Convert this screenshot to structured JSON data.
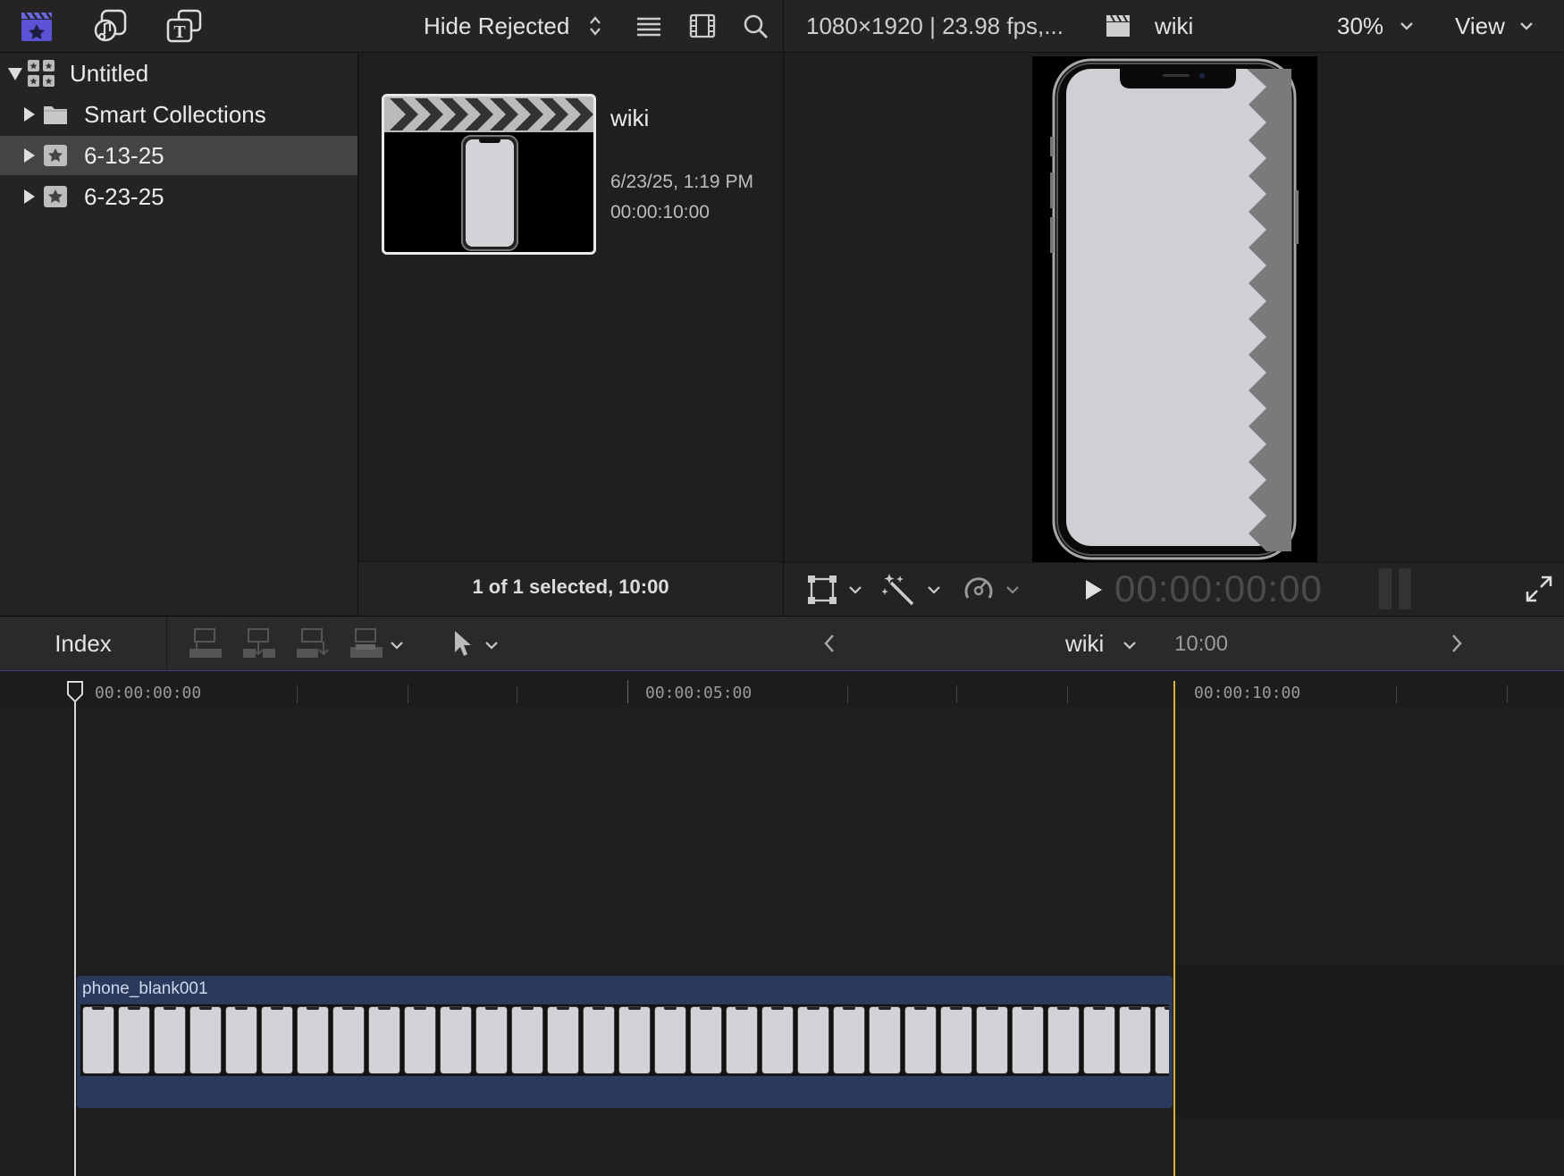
{
  "toolbar": {
    "filter_label": "Hide Rejected",
    "format_info": "1080×1920 | 23.98 fps,...",
    "project_name": "wiki",
    "zoom": "30%",
    "view_label": "View"
  },
  "library": {
    "name": "Untitled",
    "items": [
      {
        "label": "Smart Collections",
        "selected": false
      },
      {
        "label": "6-13-25",
        "selected": true
      },
      {
        "label": "6-23-25",
        "selected": false
      }
    ]
  },
  "browser": {
    "clip_name": "wiki",
    "clip_date": "6/23/25, 1:19 PM",
    "clip_duration": "00:00:10:00",
    "status": "1 of 1 selected, 10:00"
  },
  "viewer": {
    "timecode": "00:00:00:00"
  },
  "timeline_header": {
    "index_label": "Index",
    "project_name": "wiki",
    "duration": "10:00"
  },
  "timeline": {
    "ruler_labels": [
      "00:00:00:00",
      "00:00:05:00",
      "00:00:10:00"
    ],
    "clip_name": "phone_blank001",
    "project_length_fraction": 1.0
  },
  "colors": {
    "accent": "#5b52d6",
    "clip_bg": "#2a3a5c",
    "end_marker": "#d8b23a",
    "selection": "#444444"
  }
}
